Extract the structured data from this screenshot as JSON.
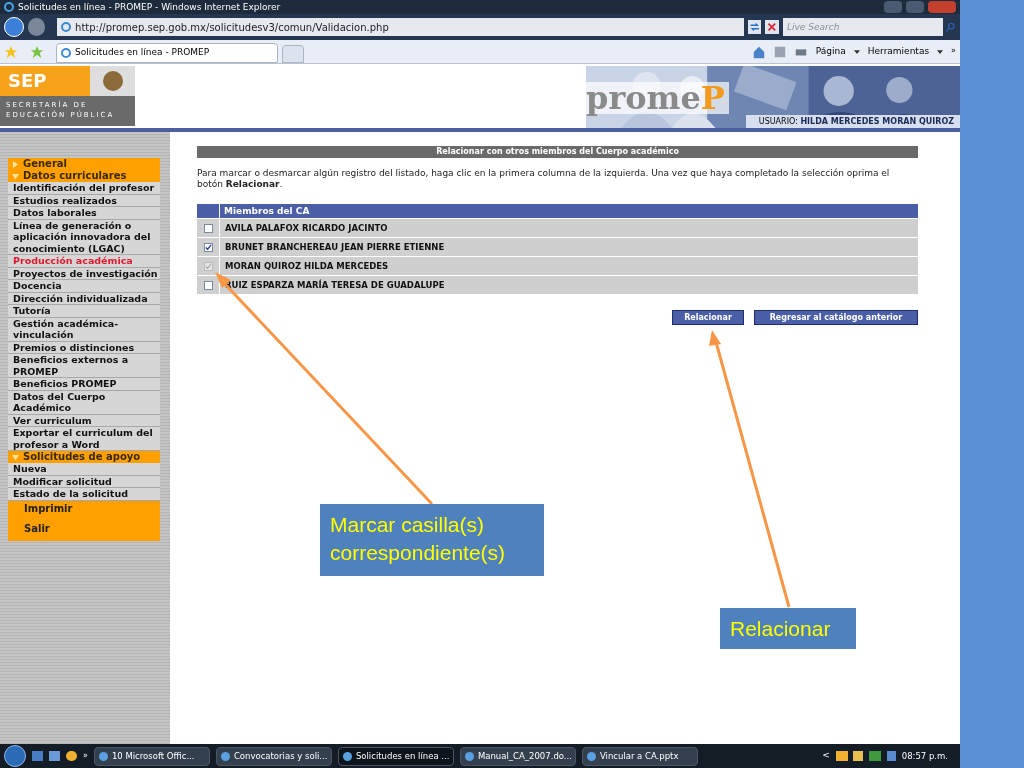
{
  "window": {
    "title": "Solicitudes en línea - PROMEP - Windows Internet Explorer"
  },
  "address_bar": {
    "url": "http://promep.sep.gob.mx/solicitudesv3/comun/Validacion.php",
    "search_placeholder": "Live Search"
  },
  "tabs": [
    {
      "label": "Solicitudes en línea - PROMEP",
      "selected": true
    }
  ],
  "toolbar": {
    "buttons": [
      "Página",
      "Herramientas"
    ],
    "overflow": "»"
  },
  "header": {
    "sep_logo": {
      "title": "SEP",
      "line1": "SECRETARÍA DE",
      "line2": "EDUCACIÓN PÚBLICA"
    },
    "logo": {
      "text": "prome",
      "accent": "P"
    },
    "user_label": "USUARIO:",
    "user_name": "HILDA MERCEDES MORAN QUIROZ"
  },
  "sidebar": {
    "items": [
      {
        "kind": "section",
        "label": "General",
        "expanded": false
      },
      {
        "kind": "section",
        "label": "Datos curriculares",
        "expanded": true
      },
      {
        "kind": "link",
        "label": "Identificación del profesor",
        "selected": false
      },
      {
        "kind": "link",
        "label": "Estudios realizados",
        "selected": false
      },
      {
        "kind": "link",
        "label": "Datos laborales",
        "selected": false
      },
      {
        "kind": "link",
        "label": "Línea de generación o aplicación innovadora del conocimiento (LGAC)",
        "selected": false
      },
      {
        "kind": "link",
        "label": "Producción académica",
        "selected": true
      },
      {
        "kind": "link",
        "label": "Proyectos de investigación",
        "selected": false
      },
      {
        "kind": "link",
        "label": "Docencia",
        "selected": false
      },
      {
        "kind": "link",
        "label": "Dirección individualizada",
        "selected": false
      },
      {
        "kind": "link",
        "label": "Tutoría",
        "selected": false
      },
      {
        "kind": "link",
        "label": "Gestión académica-vinculación",
        "selected": false
      },
      {
        "kind": "link",
        "label": "Premios o distinciones",
        "selected": false
      },
      {
        "kind": "link",
        "label": "Beneficios externos a PROMEP",
        "selected": false
      },
      {
        "kind": "link",
        "label": "Beneficios PROMEP",
        "selected": false
      },
      {
        "kind": "link",
        "label": "Datos del Cuerpo Académico",
        "selected": false
      },
      {
        "kind": "link",
        "label": "Ver curriculum",
        "selected": false
      },
      {
        "kind": "link",
        "label": "Exportar el curriculum del profesor a Word",
        "selected": false
      },
      {
        "kind": "section",
        "label": "Solicitudes de apoyo",
        "expanded": true
      },
      {
        "kind": "link",
        "label": "Nueva",
        "selected": false
      },
      {
        "kind": "link",
        "label": "Modificar solicitud",
        "selected": false
      },
      {
        "kind": "link",
        "label": "Estado de la solicitud",
        "selected": false
      },
      {
        "kind": "action",
        "label": "Imprimir"
      },
      {
        "kind": "action",
        "label": "Salir"
      }
    ]
  },
  "main": {
    "title": "Relacionar con otros miembros del Cuerpo académico",
    "instructions": "Para marcar o desmarcar algún registro del listado, haga clic en la primera columna de la izquierda. Una vez que haya completado la selección oprima el botón **Relacionar**.",
    "table": {
      "columns": [
        "Miembros del CA"
      ],
      "rows": [
        {
          "name": "AVILA PALAFOX RICARDO JACINTO",
          "checked": false,
          "disabled": false
        },
        {
          "name": "BRUNET BRANCHEREAU JEAN PIERRE ETIENNE",
          "checked": true,
          "disabled": false
        },
        {
          "name": "MORAN QUIROZ HILDA MERCEDES",
          "checked": true,
          "disabled": true
        },
        {
          "name": "RUIZ ESPARZA MARÍA TERESA DE GUADALUPE",
          "checked": false,
          "disabled": false
        }
      ]
    },
    "buttons": [
      "Relacionar",
      "Regresar al catálogo anterior"
    ]
  },
  "callouts": [
    "Marcar casilla(s) correspondiente(s)",
    "Relacionar"
  ],
  "taskbar": {
    "overflow": "»",
    "items": [
      "10 Microsoft Offic...",
      "Convocatorias y soli...",
      "Solicitudes en línea ...",
      "Manual_CA_2007.do...",
      "Vincular a CA.pptx"
    ],
    "tray_expand": "<",
    "clock": "08:57 p.m."
  }
}
